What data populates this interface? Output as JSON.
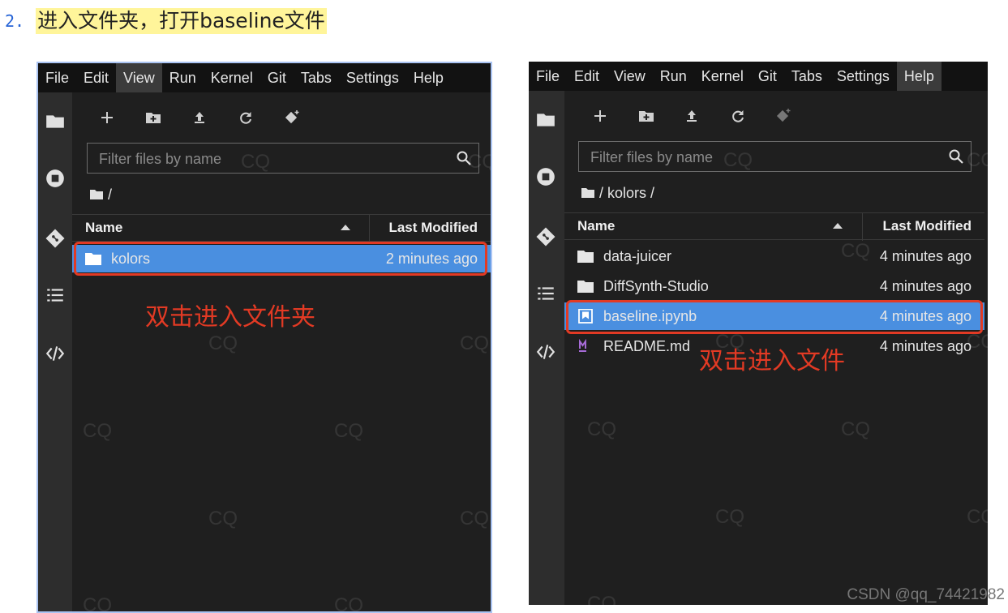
{
  "step": {
    "number": "2.",
    "text": "进入文件夹，打开baseline文件"
  },
  "menu_items": [
    "File",
    "Edit",
    "View",
    "Run",
    "Kernel",
    "Git",
    "Tabs",
    "Settings",
    "Help"
  ],
  "filter_placeholder": "Filter files by name",
  "column_headers": {
    "name": "Name",
    "modified": "Last Modified"
  },
  "left_panel": {
    "active_menu": "View",
    "breadcrumb": "/",
    "files": [
      {
        "name": "kolors",
        "modified": "2 minutes ago",
        "kind": "folder",
        "selected": true
      }
    ],
    "annotation": "双击进入文件夹"
  },
  "right_panel": {
    "active_menu": "Help",
    "breadcrumb": "/ kolors /",
    "files": [
      {
        "name": "data-juicer",
        "modified": "4 minutes ago",
        "kind": "folder",
        "selected": false
      },
      {
        "name": "DiffSynth-Studio",
        "modified": "4 minutes ago",
        "kind": "folder",
        "selected": false
      },
      {
        "name": "baseline.ipynb",
        "modified": "4 minutes ago",
        "kind": "notebook",
        "selected": true
      },
      {
        "name": "README.md",
        "modified": "4 minutes ago",
        "kind": "markdown",
        "selected": false
      }
    ],
    "annotation": "双击进入文件"
  },
  "watermark_text": "CQ",
  "credit": "CSDN @qq_74421982",
  "colors": {
    "selection": "#4a8fe0",
    "highlight_box": "#e23a24",
    "step_highlight": "#fff59a",
    "background": "#1f1f1f"
  }
}
